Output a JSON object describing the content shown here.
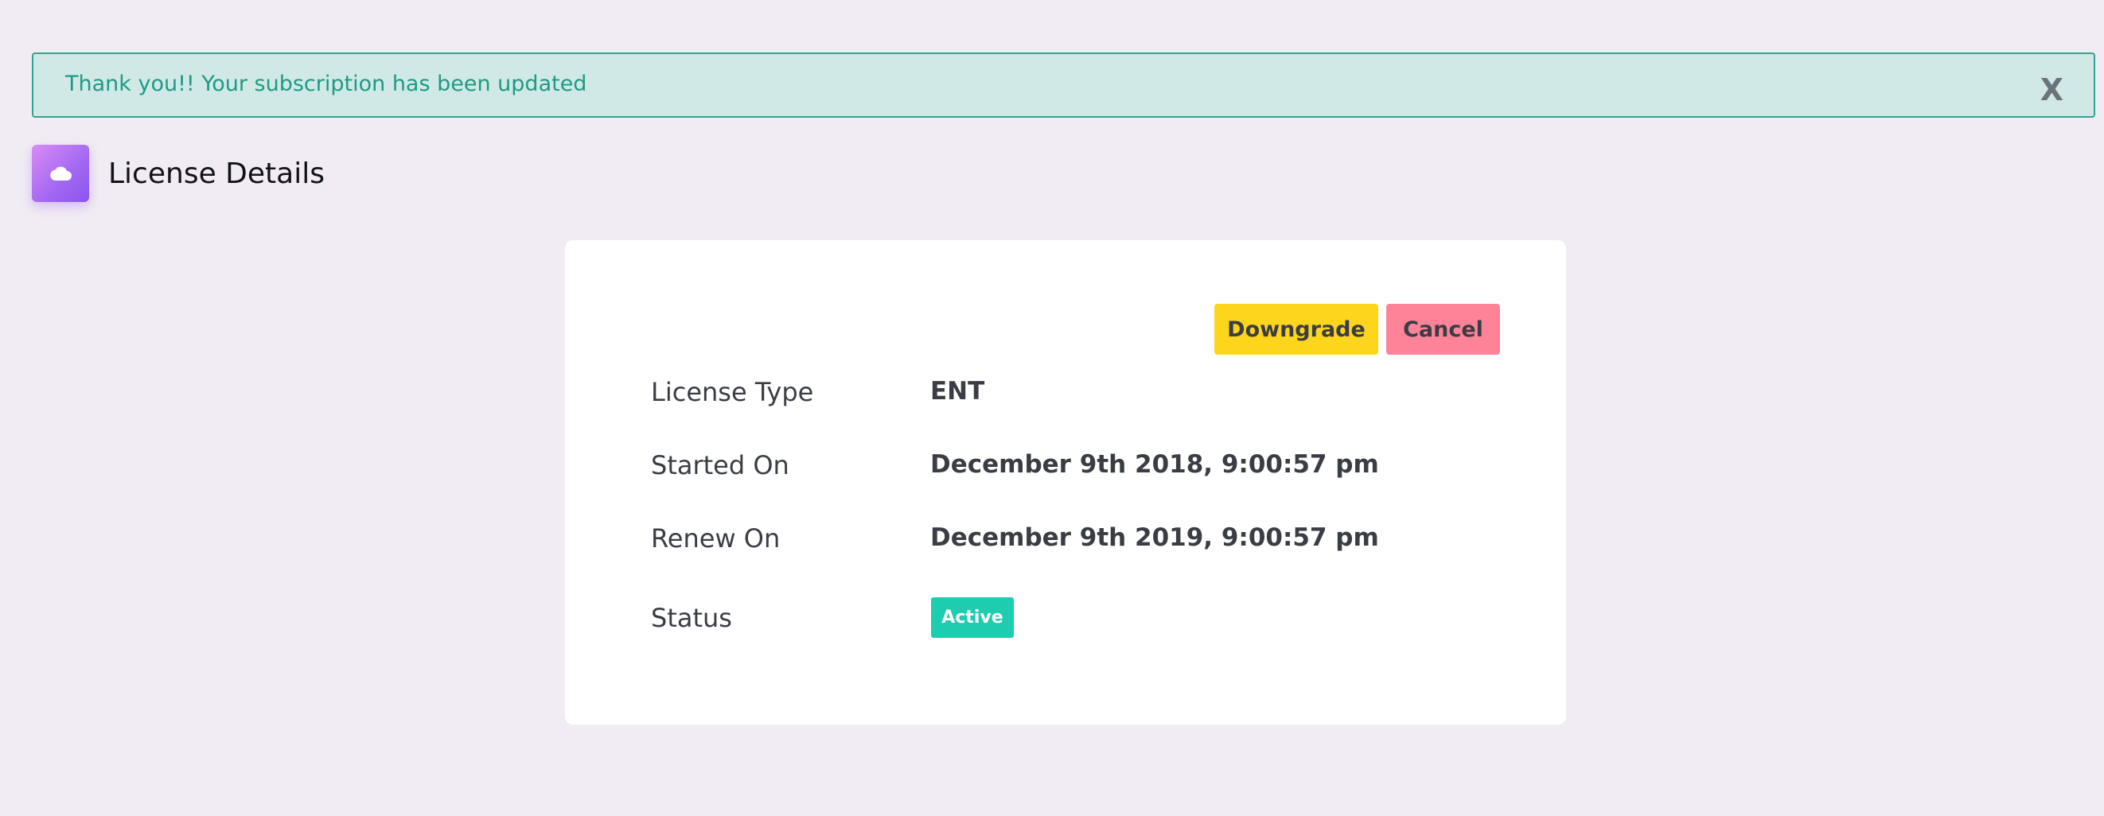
{
  "alert": {
    "message": "Thank you!! Your subscription has been updated",
    "close_label": "X"
  },
  "header": {
    "icon": "cloud-icon",
    "title": "License Details"
  },
  "actions": {
    "downgrade_label": "Downgrade",
    "cancel_label": "Cancel"
  },
  "details": [
    {
      "label": "License Type",
      "value": "ENT"
    },
    {
      "label": "Started On",
      "value": "December 9th 2018, 9:00:57 pm"
    },
    {
      "label": "Renew On",
      "value": "December 9th 2019, 9:00:57 pm"
    },
    {
      "label": "Status",
      "value": "Active"
    }
  ],
  "colors": {
    "background": "#f1ecf3",
    "alert_bg": "#d0e9e6",
    "alert_border": "#2ea58f",
    "alert_text": "#1f9a83",
    "downgrade": "#fdd51c",
    "cancel": "#fe8398",
    "status_active": "#1dcdaf",
    "icon_gradient_start": "#d98cf5",
    "icon_gradient_end": "#8b55ee"
  }
}
